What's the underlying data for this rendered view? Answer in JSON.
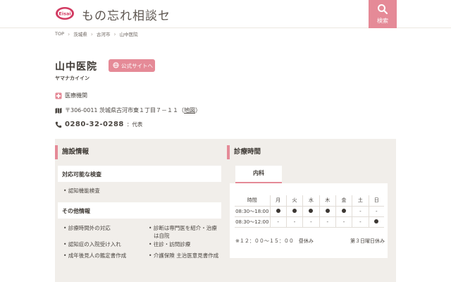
{
  "header": {
    "brand": "もの忘れ相談セ",
    "search_label": "検索"
  },
  "breadcrumb": [
    "TOP",
    "茨城県",
    "古河市",
    "山中医院"
  ],
  "facility": {
    "name": "山中医院",
    "kana": "ヤマナカイイン",
    "official_site_label": "公式サイトへ",
    "type": "医療機関",
    "address": "〒306-0011 茨城県古河市東１丁目７－１１",
    "map_label": "地図",
    "phone": "0280-32-0288",
    "phone_note": "：代表"
  },
  "facility_info": {
    "heading": "施設情報",
    "exam_heading": "対応可能な検査",
    "exams": [
      "認知機能検査"
    ],
    "other_heading": "その他情報",
    "other_left": [
      "診療時間外の対応",
      "認知症の入院受け入れ",
      "成年後見人の鑑定書作成"
    ],
    "other_right": [
      "診断は専門医を紹介・治療は自院",
      "往診・訪問診療",
      "介護保険 主治医意見書作成"
    ]
  },
  "hours": {
    "heading": "診療時間",
    "tab": "内科",
    "col_time": "時間",
    "days": [
      "月",
      "火",
      "水",
      "木",
      "金",
      "土",
      "日"
    ],
    "rows": [
      {
        "time": "08:30～18:00",
        "cells": [
          "●",
          "●",
          "●",
          "●",
          "●",
          "-",
          "-"
        ]
      },
      {
        "time": "08:30～12:00",
        "cells": [
          "-",
          "-",
          "-",
          "-",
          "-",
          "-",
          "●"
        ]
      }
    ],
    "note": "※１２：００～１５：００　昼休み",
    "note_right": "第３日曜日休み"
  },
  "colors": {
    "accent": "#e58a97",
    "panel": "#f1eeea"
  }
}
